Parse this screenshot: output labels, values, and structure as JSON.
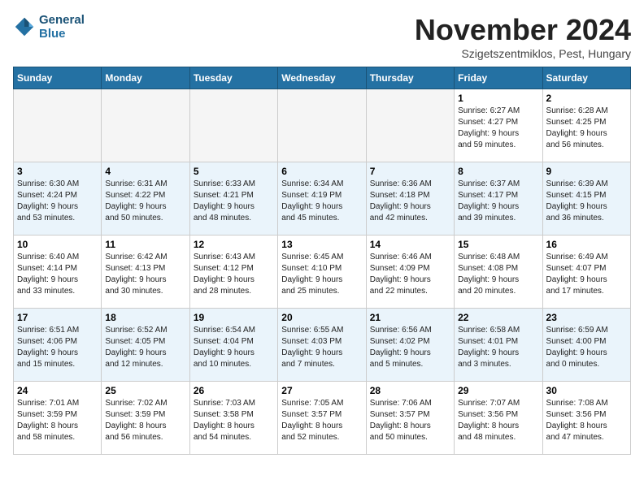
{
  "header": {
    "logo_line1": "General",
    "logo_line2": "Blue",
    "month_title": "November 2024",
    "location": "Szigetszentmiklos, Pest, Hungary"
  },
  "days_of_week": [
    "Sunday",
    "Monday",
    "Tuesday",
    "Wednesday",
    "Thursday",
    "Friday",
    "Saturday"
  ],
  "weeks": [
    [
      {
        "day": "",
        "info": ""
      },
      {
        "day": "",
        "info": ""
      },
      {
        "day": "",
        "info": ""
      },
      {
        "day": "",
        "info": ""
      },
      {
        "day": "",
        "info": ""
      },
      {
        "day": "1",
        "info": "Sunrise: 6:27 AM\nSunset: 4:27 PM\nDaylight: 9 hours\nand 59 minutes."
      },
      {
        "day": "2",
        "info": "Sunrise: 6:28 AM\nSunset: 4:25 PM\nDaylight: 9 hours\nand 56 minutes."
      }
    ],
    [
      {
        "day": "3",
        "info": "Sunrise: 6:30 AM\nSunset: 4:24 PM\nDaylight: 9 hours\nand 53 minutes."
      },
      {
        "day": "4",
        "info": "Sunrise: 6:31 AM\nSunset: 4:22 PM\nDaylight: 9 hours\nand 50 minutes."
      },
      {
        "day": "5",
        "info": "Sunrise: 6:33 AM\nSunset: 4:21 PM\nDaylight: 9 hours\nand 48 minutes."
      },
      {
        "day": "6",
        "info": "Sunrise: 6:34 AM\nSunset: 4:19 PM\nDaylight: 9 hours\nand 45 minutes."
      },
      {
        "day": "7",
        "info": "Sunrise: 6:36 AM\nSunset: 4:18 PM\nDaylight: 9 hours\nand 42 minutes."
      },
      {
        "day": "8",
        "info": "Sunrise: 6:37 AM\nSunset: 4:17 PM\nDaylight: 9 hours\nand 39 minutes."
      },
      {
        "day": "9",
        "info": "Sunrise: 6:39 AM\nSunset: 4:15 PM\nDaylight: 9 hours\nand 36 minutes."
      }
    ],
    [
      {
        "day": "10",
        "info": "Sunrise: 6:40 AM\nSunset: 4:14 PM\nDaylight: 9 hours\nand 33 minutes."
      },
      {
        "day": "11",
        "info": "Sunrise: 6:42 AM\nSunset: 4:13 PM\nDaylight: 9 hours\nand 30 minutes."
      },
      {
        "day": "12",
        "info": "Sunrise: 6:43 AM\nSunset: 4:12 PM\nDaylight: 9 hours\nand 28 minutes."
      },
      {
        "day": "13",
        "info": "Sunrise: 6:45 AM\nSunset: 4:10 PM\nDaylight: 9 hours\nand 25 minutes."
      },
      {
        "day": "14",
        "info": "Sunrise: 6:46 AM\nSunset: 4:09 PM\nDaylight: 9 hours\nand 22 minutes."
      },
      {
        "day": "15",
        "info": "Sunrise: 6:48 AM\nSunset: 4:08 PM\nDaylight: 9 hours\nand 20 minutes."
      },
      {
        "day": "16",
        "info": "Sunrise: 6:49 AM\nSunset: 4:07 PM\nDaylight: 9 hours\nand 17 minutes."
      }
    ],
    [
      {
        "day": "17",
        "info": "Sunrise: 6:51 AM\nSunset: 4:06 PM\nDaylight: 9 hours\nand 15 minutes."
      },
      {
        "day": "18",
        "info": "Sunrise: 6:52 AM\nSunset: 4:05 PM\nDaylight: 9 hours\nand 12 minutes."
      },
      {
        "day": "19",
        "info": "Sunrise: 6:54 AM\nSunset: 4:04 PM\nDaylight: 9 hours\nand 10 minutes."
      },
      {
        "day": "20",
        "info": "Sunrise: 6:55 AM\nSunset: 4:03 PM\nDaylight: 9 hours\nand 7 minutes."
      },
      {
        "day": "21",
        "info": "Sunrise: 6:56 AM\nSunset: 4:02 PM\nDaylight: 9 hours\nand 5 minutes."
      },
      {
        "day": "22",
        "info": "Sunrise: 6:58 AM\nSunset: 4:01 PM\nDaylight: 9 hours\nand 3 minutes."
      },
      {
        "day": "23",
        "info": "Sunrise: 6:59 AM\nSunset: 4:00 PM\nDaylight: 9 hours\nand 0 minutes."
      }
    ],
    [
      {
        "day": "24",
        "info": "Sunrise: 7:01 AM\nSunset: 3:59 PM\nDaylight: 8 hours\nand 58 minutes."
      },
      {
        "day": "25",
        "info": "Sunrise: 7:02 AM\nSunset: 3:59 PM\nDaylight: 8 hours\nand 56 minutes."
      },
      {
        "day": "26",
        "info": "Sunrise: 7:03 AM\nSunset: 3:58 PM\nDaylight: 8 hours\nand 54 minutes."
      },
      {
        "day": "27",
        "info": "Sunrise: 7:05 AM\nSunset: 3:57 PM\nDaylight: 8 hours\nand 52 minutes."
      },
      {
        "day": "28",
        "info": "Sunrise: 7:06 AM\nSunset: 3:57 PM\nDaylight: 8 hours\nand 50 minutes."
      },
      {
        "day": "29",
        "info": "Sunrise: 7:07 AM\nSunset: 3:56 PM\nDaylight: 8 hours\nand 48 minutes."
      },
      {
        "day": "30",
        "info": "Sunrise: 7:08 AM\nSunset: 3:56 PM\nDaylight: 8 hours\nand 47 minutes."
      }
    ]
  ]
}
